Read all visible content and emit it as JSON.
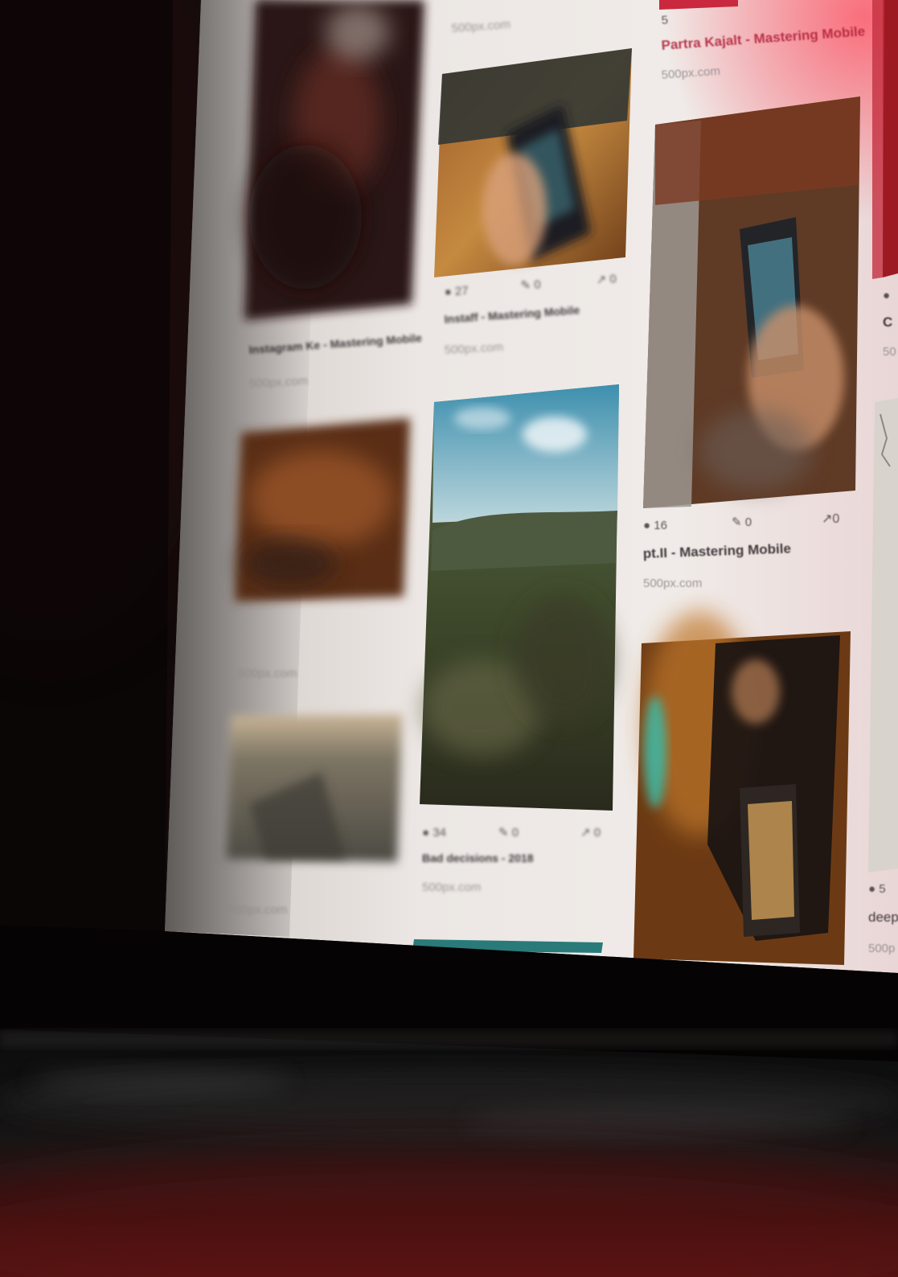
{
  "cards": {
    "top_right": {
      "views": "5",
      "title": "Partra Kajalt - Mastering Mobile",
      "source": "500px.com"
    },
    "left_top": {
      "title": "Instagram Ke - Mastering Mobile",
      "source": "500px.com"
    },
    "mid_phone": {
      "views": "27",
      "saves": "0",
      "shares": "0",
      "title": "Instaff - Mastering Mobile",
      "source": "500px.com"
    },
    "right_phone": {
      "views": "16",
      "saves": "0",
      "shares": "0",
      "title": "pt.II - Mastering Mobile",
      "source": "500px.com"
    },
    "mid_mountain": {
      "views": "34",
      "saves": "0",
      "shares": "0",
      "title": "Bad decisions - 2018",
      "source": "500px.com"
    },
    "left_mid": {
      "source": "500px.com"
    },
    "left_bottom": {
      "source": "500px.com"
    },
    "far_right_top": {
      "title_fragment": "C",
      "source_fragment": "50"
    },
    "far_right_bottom": {
      "views": "5",
      "title_fragment": "deep",
      "source_fragment": "500p"
    }
  },
  "icons": {
    "views": "eye-icon",
    "saves": "pin-icon",
    "shares": "arrow-up-right-icon"
  },
  "colors": {
    "screen_white": "#efebea",
    "bezel": "#060404",
    "accent_red": "#c9283f",
    "ambient_red": "#7d1012",
    "table": "#3a0d0c"
  }
}
